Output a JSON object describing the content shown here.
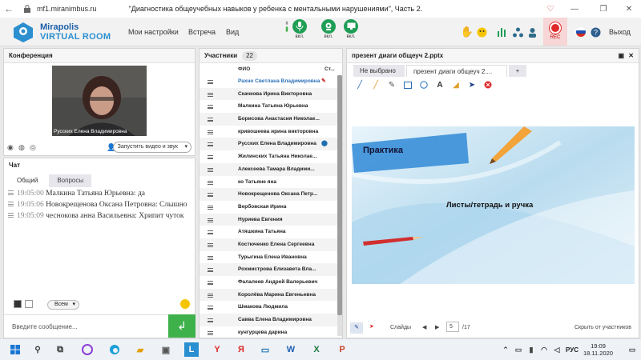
{
  "browser": {
    "url": "mf1.miranimbus.ru",
    "title": "\"Диагностика общеучебных навыков у ребенка с ментальными нарушениями\", Часть 2."
  },
  "header": {
    "logo_line1": "Mirapolis",
    "logo_line2": "VIRTUAL ROOM",
    "menu": [
      "Мои настройки",
      "Встреча",
      "Вид"
    ],
    "toggles": [
      {
        "icon": "microphone-icon",
        "label": "вкл."
      },
      {
        "icon": "webcam-icon",
        "label": "вкл."
      },
      {
        "icon": "screen-share-icon",
        "label": "вкл."
      }
    ],
    "rec_label": "REC",
    "exit_label": "Выход"
  },
  "conference": {
    "title": "Конференция",
    "video_caption": "Русских Елена Владимировна",
    "start_button": "Запустить видео и звук"
  },
  "chat": {
    "title": "Чат",
    "tabs": [
      "Общий",
      "Вопросы"
    ],
    "messages": [
      {
        "time": "19:05:00",
        "author": "Малкина Татьяна  Юрьевна:",
        "text": "да"
      },
      {
        "time": "19:05:06",
        "author": "Новокрещенова  Оксана Петровна:",
        "text": "Слышно"
      },
      {
        "time": "19:05:09",
        "author": "чеснокова  анна Васильевна:",
        "text": "Хрипит чуток"
      }
    ],
    "recipient": "Всем",
    "input_placeholder": "Введите сообщение..."
  },
  "participants": {
    "title": "Участники",
    "count": "22",
    "col_name": "ФИО",
    "col_status": "Ст...",
    "list": [
      "Рахно Светлана  Владимировна",
      "Скачкова  Ирина Викторовна",
      "Малкина Татьяна  Юрьевна",
      "Борисова  Анастасия Николае...",
      "кривошеева ирина викторовна",
      "Русских Елена Владимировна",
      "Жилинских  Татьяна  Николае...",
      "Алексеева  Тамара  Владими...",
      "ко Татьяне яна",
      "Новокрещенова  Оксана  Петр...",
      "Вербовская Ирина",
      "Нуриева Евгения",
      "Атяшкина Татьяна",
      "Костюченко  Елена  Сергеевна",
      "Турыгина  Елена  Ивановна",
      "Рохмистрова  Елизавета  Вла...",
      "Фалалеев  Андрей  Валерьевич",
      "Королёва Марина Евгеньевна",
      "Шмакова Людмила",
      "Савва Елена Владимировна",
      "кунгурцева   дарина"
    ]
  },
  "presentation": {
    "title": "презент диаги общеуч 2.pptx",
    "tabs": [
      "Не выбрано",
      "презент диаги общеуч 2...."
    ],
    "add_tab": "+",
    "slide_heading": "Практика",
    "slide_text": "Листы/тетрадь и ручка",
    "slides_label": "Слайды",
    "page_current": "5",
    "page_total": "/17",
    "hide_label": "Скрыть от участников"
  },
  "taskbar": {
    "lang": "РУС",
    "time": "19:09",
    "date": "18.11.2020"
  },
  "colors": {
    "accent_green": "#1f9e56",
    "send_green": "#3fb14a",
    "rec_red": "#e02929",
    "slide_banner": "#3a8fd8"
  }
}
